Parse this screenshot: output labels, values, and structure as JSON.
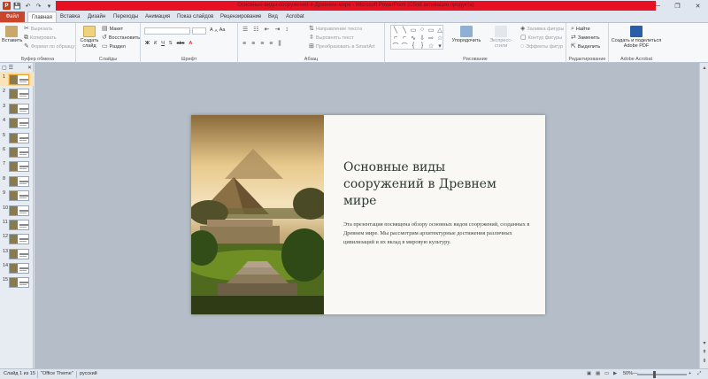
{
  "window": {
    "title": "Основные-виды-сооружений-в-Древнем-мире - Microsoft PowerPoint (Сбой активации продукта)",
    "controls": [
      "—",
      "❐",
      "✕"
    ]
  },
  "qat": {
    "app": "P",
    "save": "💾",
    "undo": "↶",
    "redo": "↷",
    "customize": "▾"
  },
  "tabs": [
    "Файл",
    "Главная",
    "Вставка",
    "Дизайн",
    "Переходы",
    "Анимация",
    "Показ слайдов",
    "Рецензирование",
    "Вид",
    "Acrobat"
  ],
  "ribbon": {
    "clipboard": {
      "label": "Буфер обмена",
      "paste": "Вставить",
      "cut": "Вырезать",
      "copy": "Копировать",
      "format_painter": "Формат по образцу"
    },
    "slides": {
      "label": "Слайды",
      "new_slide": "Создать слайд",
      "layout": "Макет",
      "reset": "Восстановить",
      "section": "Раздел"
    },
    "font": {
      "label": "Шрифт",
      "b": "Ж",
      "i": "К",
      "u": "Ч",
      "s": "S",
      "abc": "abc",
      "size_up": "A",
      "size_down": "A",
      "clear": "Aa",
      "color": "A"
    },
    "paragraph": {
      "label": "Абзац",
      "text_direction": "Направление текста",
      "align_text": "Выровнять текст",
      "smartart": "Преобразовать в SmartArt"
    },
    "drawing": {
      "label": "Рисование",
      "arrange": "Упорядочить",
      "quick_styles": "Экспресс-стили",
      "fill": "Заливка фигуры",
      "outline": "Контур фигуры",
      "effects": "Эффекты фигур"
    },
    "editing": {
      "label": "Редактирование",
      "find": "Найти",
      "replace": "Заменить",
      "select": "Выделить"
    },
    "acrobat": {
      "label": "Adobe Acrobat",
      "create": "Создать и поделиться Adobe PDF"
    }
  },
  "panel": {
    "tab_outline": "▢",
    "tab_slides": "☰",
    "close": "✕"
  },
  "thumbnails": [
    "1",
    "2",
    "3",
    "4",
    "5",
    "6",
    "7",
    "8",
    "9",
    "10",
    "11",
    "12",
    "13",
    "14",
    "15"
  ],
  "slide": {
    "title": "Основные виды сооружений в Древнем мире",
    "body": "Эта презентация посвящена обзору основных видов сооружений, созданных в Древнем мире. Мы рассмотрим архитектурные достижения различных цивилизаций и их вклад в мировую культуру."
  },
  "status": {
    "slide_of": "Слайд 1 из 15",
    "theme": "\"Office Theme\"",
    "language": "русский",
    "zoom": "50%",
    "zoom_minus": "—",
    "zoom_plus": "+"
  }
}
